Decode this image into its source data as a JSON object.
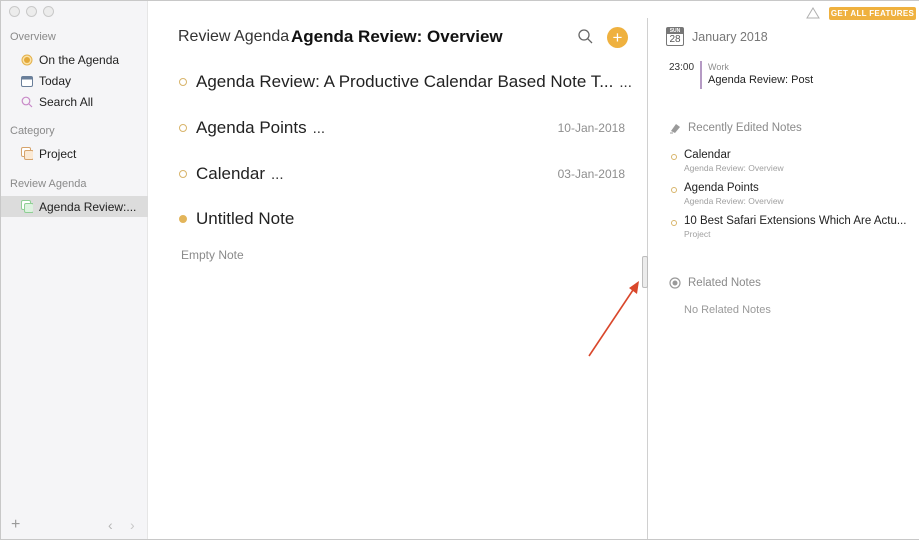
{
  "window": {
    "controls": [
      "close",
      "minimize",
      "zoom"
    ]
  },
  "sidebar": {
    "sections": [
      {
        "label": "Overview",
        "items": [
          {
            "label": "On the Agenda",
            "icon": "agenda-dot-icon"
          },
          {
            "label": "Today",
            "icon": "calendar-icon"
          },
          {
            "label": "Search All",
            "icon": "search-icon"
          }
        ]
      },
      {
        "label": "Category",
        "items": [
          {
            "label": "Project",
            "icon": "category-icon"
          }
        ]
      },
      {
        "label": "Review Agenda",
        "items": [
          {
            "label": "Agenda Review:...",
            "icon": "project-icon",
            "selected": true
          }
        ]
      }
    ],
    "footer": {
      "add": "+",
      "back": "‹",
      "forward": "›"
    }
  },
  "main": {
    "breadcrumb": "Review Agenda",
    "title": "Agenda Review: Overview",
    "add_symbol": "+",
    "notes": [
      {
        "title": "Agenda Review: A Productive Calendar Based Note T...",
        "more": "...",
        "date": "",
        "filled": false
      },
      {
        "title": "Agenda Points",
        "more": "...",
        "date": "10-Jan-2018",
        "filled": false
      },
      {
        "title": "Calendar",
        "more": "...",
        "date": "03-Jan-2018",
        "filled": false
      },
      {
        "title": "Untitled Note",
        "more": "",
        "date": "",
        "filled": true
      }
    ],
    "empty_note": "Empty Note"
  },
  "right": {
    "features_button": "GET ALL FEATURES",
    "calendar": {
      "dow": "SUN",
      "day": "28",
      "month": "January 2018"
    },
    "event": {
      "time": "23:00",
      "calendar": "Work",
      "title": "Agenda Review: Post"
    },
    "recent": {
      "heading": "Recently Edited Notes",
      "items": [
        {
          "title": "Calendar",
          "sub": "Agenda Review: Overview"
        },
        {
          "title": "Agenda Points",
          "sub": "Agenda Review: Overview"
        },
        {
          "title": "10 Best Safari Extensions Which Are Actu...",
          "sub": "Project"
        }
      ]
    },
    "related": {
      "heading": "Related Notes",
      "empty": "No Related Notes"
    }
  },
  "colors": {
    "accent": "#efb13f",
    "event_bar": "#b59ac4",
    "annotation_arrow": "#d9472b"
  }
}
